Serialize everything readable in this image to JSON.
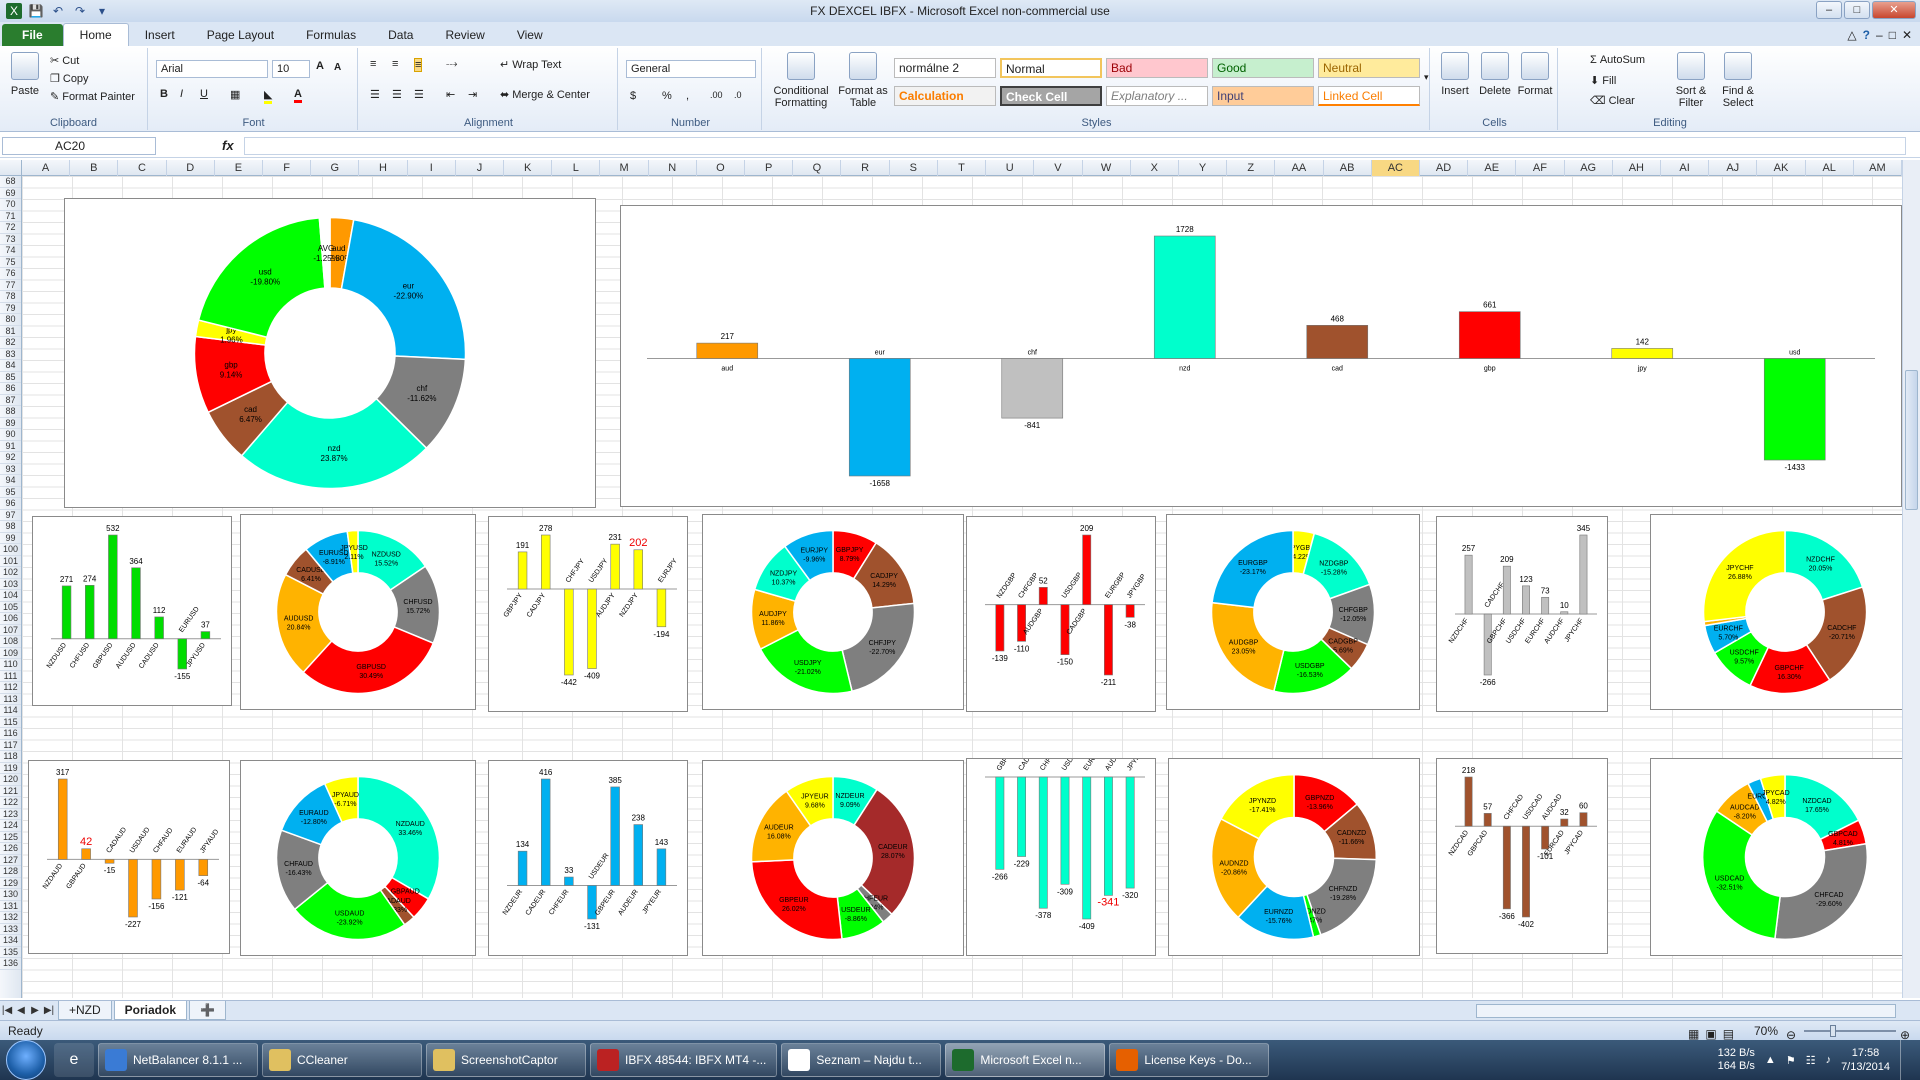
{
  "window": {
    "title": "FX DEXCEL IBFX - Microsoft Excel non-commercial use"
  },
  "tabs": [
    "File",
    "Home",
    "Insert",
    "Page Layout",
    "Formulas",
    "Data",
    "Review",
    "View"
  ],
  "ribbon": {
    "clipboard": {
      "paste": "Paste",
      "cut": "Cut",
      "copy": "Copy",
      "painter": "Format Painter",
      "label": "Clipboard"
    },
    "font": {
      "name": "Arial",
      "size": "10",
      "label": "Font"
    },
    "alignment": {
      "wrap": "Wrap Text",
      "merge": "Merge & Center",
      "label": "Alignment"
    },
    "number": {
      "format": "General",
      "label": "Number"
    },
    "styles": {
      "cond": "Conditional Formatting",
      "table": "Format as Table",
      "normal2": "normálne 2",
      "normal": "Normal",
      "bad": "Bad",
      "good": "Good",
      "neutral": "Neutral",
      "calc": "Calculation",
      "check": "Check Cell",
      "explan": "Explanatory ...",
      "input": "Input",
      "linked": "Linked Cell",
      "label": "Styles"
    },
    "cells": {
      "insert": "Insert",
      "delete": "Delete",
      "format": "Format",
      "label": "Cells"
    },
    "editing": {
      "autosum": "AutoSum",
      "fill": "Fill",
      "clear": "Clear",
      "sort": "Sort & Filter",
      "find": "Find & Select",
      "label": "Editing"
    }
  },
  "formula_bar": {
    "namebox": "AC20",
    "fx": "fx"
  },
  "columns": [
    "A",
    "B",
    "C",
    "D",
    "E",
    "F",
    "G",
    "H",
    "I",
    "J",
    "K",
    "L",
    "M",
    "N",
    "O",
    "P",
    "Q",
    "R",
    "S",
    "T",
    "U",
    "V",
    "W",
    "X",
    "Y",
    "Z",
    "AA",
    "AB",
    "AC",
    "AD",
    "AE",
    "AF",
    "AG",
    "AH",
    "AI",
    "AJ",
    "AK",
    "AL",
    "AM"
  ],
  "selected_column": "AC",
  "row_start": 68,
  "row_end": 136,
  "colors": {
    "aud": "#ff9900",
    "eur": "#00b0f0",
    "chf": "#7f7f7f",
    "nzd": "#00ffcc",
    "cad": "#a0522d",
    "gbp": "#ff0000",
    "jpy": "#ffff00",
    "usd": "#00ff00",
    "neg_usd": "#00cc00"
  },
  "chart_data": [
    {
      "type": "pie",
      "id": "main-donut",
      "slices": [
        {
          "label": "aud",
          "pct": "-2.80%",
          "value": 2.8,
          "color": "#ff9900"
        },
        {
          "label": "eur",
          "pct": "-22.90%",
          "value": 22.9,
          "color": "#00b0f0"
        },
        {
          "label": "chf",
          "pct": "-11.62%",
          "value": 11.62,
          "color": "#7f7f7f"
        },
        {
          "label": "nzd",
          "pct": "23.87%",
          "value": 23.87,
          "color": "#00ffcc"
        },
        {
          "label": "cad",
          "pct": "6.47%",
          "value": 6.47,
          "color": "#a0522d"
        },
        {
          "label": "gbp",
          "pct": "9.14%",
          "value": 9.14,
          "color": "#ff0000"
        },
        {
          "label": "jpy",
          "pct": "1.96%",
          "value": 1.96,
          "color": "#ffff00"
        },
        {
          "label": "usd",
          "pct": "-19.80%",
          "value": 19.8,
          "color": "#00ff00"
        },
        {
          "label": "AVG",
          "pct": "-1.25%",
          "value": 1.25,
          "color": "#ffffff"
        }
      ]
    },
    {
      "type": "bar",
      "id": "main-bar",
      "categories": [
        "aud",
        "eur",
        "chf",
        "nzd",
        "cad",
        "gbp",
        "jpy",
        "usd"
      ],
      "values": [
        217,
        -1658,
        -841,
        1728,
        468,
        661,
        142,
        -1433
      ],
      "colors": [
        "#ff9900",
        "#00b0f0",
        "#c0c0c0",
        "#00ffcc",
        "#a0522d",
        "#ff0000",
        "#ffff00",
        "#00ff00"
      ],
      "ylim": [
        -1800,
        1850
      ]
    },
    {
      "type": "bar",
      "id": "usd-bar",
      "categories": [
        "NZDUSD",
        "CHFUSD",
        "GBPUSD",
        "AUDUSD",
        "CADUSD",
        "EURUSD",
        "JPYUSD"
      ],
      "values": [
        271,
        274,
        532,
        364,
        112,
        -155,
        37
      ],
      "color": "#00dd00"
    },
    {
      "type": "pie",
      "id": "usd-donut",
      "slices": [
        {
          "label": "NZDUSD",
          "pct": "15.52%",
          "value": 15.52,
          "color": "#00ffcc"
        },
        {
          "label": "CHFUSD",
          "pct": "15.72%",
          "value": 15.72,
          "color": "#7f7f7f"
        },
        {
          "label": "GBPUSD",
          "pct": "30.49%",
          "value": 30.49,
          "color": "#ff0000"
        },
        {
          "label": "AUDUSD",
          "pct": "20.84%",
          "value": 20.84,
          "color": "#ffb300"
        },
        {
          "label": "CADUSD",
          "pct": "6.41%",
          "value": 6.41,
          "color": "#a0522d"
        },
        {
          "label": "EURUSD",
          "pct": "-8.91%",
          "value": 8.91,
          "color": "#00b0f0"
        },
        {
          "label": "JPYUSD",
          "pct": "2.11%",
          "value": 2.11,
          "color": "#ffff00"
        }
      ]
    },
    {
      "type": "bar",
      "id": "jpy-bar",
      "categories": [
        "GBPJPY",
        "CADJPY",
        "CHFJPY",
        "USDJPY",
        "AUDJPY",
        "NZDJPY",
        "EURJPY"
      ],
      "values": [
        191,
        278,
        -442,
        -409,
        231,
        202,
        -194
      ],
      "highlight": [
        5
      ],
      "color": "#ffff00"
    },
    {
      "type": "pie",
      "id": "jpy-donut",
      "slices": [
        {
          "label": "GBPJPY",
          "pct": "8.79%",
          "value": 8.79,
          "color": "#ff0000"
        },
        {
          "label": "CADJPY",
          "pct": "14.29%",
          "value": 14.29,
          "color": "#a0522d"
        },
        {
          "label": "CHFJPY",
          "pct": "-22.70%",
          "value": 22.7,
          "color": "#7f7f7f"
        },
        {
          "label": "USDJPY",
          "pct": "-21.02%",
          "value": 21.02,
          "color": "#00ff00"
        },
        {
          "label": "AUDJPY",
          "pct": "11.86%",
          "value": 11.86,
          "color": "#ffb300"
        },
        {
          "label": "NZDJPY",
          "pct": "10.37%",
          "value": 10.37,
          "color": "#00ffcc"
        },
        {
          "label": "EURJPY",
          "pct": "-9.96%",
          "value": 9.96,
          "color": "#00b0f0"
        }
      ]
    },
    {
      "type": "bar",
      "id": "gbp-bar",
      "categories": [
        "NZDGBP",
        "CHFGBP",
        "AUDGBP",
        "USDGBP",
        "CADGBP",
        "EURGBP",
        "JPYGBP"
      ],
      "values": [
        -139,
        -110,
        52,
        -150,
        209,
        -211,
        -38
      ],
      "color": "#ff0000"
    },
    {
      "type": "pie",
      "id": "gbp-donut",
      "slices": [
        {
          "label": "JPYGBP",
          "pct": "-4.22%",
          "value": 4.22,
          "color": "#ffff00"
        },
        {
          "label": "NZDGBP",
          "pct": "-15.28%",
          "value": 15.28,
          "color": "#00ffcc"
        },
        {
          "label": "CHFGBP",
          "pct": "-12.05%",
          "value": 12.05,
          "color": "#7f7f7f"
        },
        {
          "label": "CADGBP",
          "pct": "5.69%",
          "value": 5.69,
          "color": "#a0522d"
        },
        {
          "label": "USDGBP",
          "pct": "-16.53%",
          "value": 16.53,
          "color": "#00ff00"
        },
        {
          "label": "AUDGBP",
          "pct": "23.05%",
          "value": 23.05,
          "color": "#ffb300"
        },
        {
          "label": "EURGBP",
          "pct": "-23.17%",
          "value": 23.17,
          "color": "#00b0f0"
        }
      ]
    },
    {
      "type": "bar",
      "id": "chf-bar",
      "categories": [
        "NZDCHF",
        "CADCHF",
        "GBPCHF",
        "USDCHF",
        "EURCHF",
        "AUDCHF",
        "JPYCHF"
      ],
      "values": [
        257,
        -266,
        209,
        123,
        73,
        10,
        345
      ],
      "color": "#c0c0c0"
    },
    {
      "type": "pie",
      "id": "chf-donut",
      "slices": [
        {
          "label": "NZDCHF",
          "pct": "20.05%",
          "value": 20.05,
          "color": "#00ffcc"
        },
        {
          "label": "CADCHF",
          "pct": "-20.71%",
          "value": 20.71,
          "color": "#a0522d"
        },
        {
          "label": "GBPCHF",
          "pct": "16.30%",
          "value": 16.3,
          "color": "#ff0000"
        },
        {
          "label": "USDCHF",
          "pct": "9.57%",
          "value": 9.57,
          "color": "#00ff00"
        },
        {
          "label": "EURCHF",
          "pct": "5.70%",
          "value": 5.7,
          "color": "#00b0f0"
        },
        {
          "label": "AUDCHF",
          "pct": "",
          "value": 0.8,
          "color": "#ffb300"
        },
        {
          "label": "JPYCHF",
          "pct": "26.88%",
          "value": 26.88,
          "color": "#ffff00"
        }
      ]
    },
    {
      "type": "bar",
      "id": "aud-bar",
      "categories": [
        "NZDAUD",
        "GBPAUD",
        "CADAUD",
        "USDAUD",
        "CHFAUD",
        "EURAUD",
        "JPYAUD"
      ],
      "values": [
        317,
        42,
        -15,
        -227,
        -156,
        -121,
        -64
      ],
      "highlight": [
        1
      ],
      "color": "#ff9900"
    },
    {
      "type": "pie",
      "id": "aud-donut",
      "slices": [
        {
          "label": "NZDAUD",
          "pct": "33.46%",
          "value": 33.46,
          "color": "#00ffcc"
        },
        {
          "label": "GBPAUD",
          "pct": "",
          "value": 4.6,
          "color": "#ff0000"
        },
        {
          "label": "CADAUD",
          "pct": "-2.33%",
          "value": 2.33,
          "color": "#a0522d"
        },
        {
          "label": "USDAUD",
          "pct": "-23.92%",
          "value": 23.92,
          "color": "#00ff00"
        },
        {
          "label": "CHFAUD",
          "pct": "-16.43%",
          "value": 16.43,
          "color": "#7f7f7f"
        },
        {
          "label": "EURAUD",
          "pct": "-12.80%",
          "value": 12.8,
          "color": "#00b0f0"
        },
        {
          "label": "JPYAUD",
          "pct": "-6.71%",
          "value": 6.71,
          "color": "#ffff00"
        }
      ]
    },
    {
      "type": "bar",
      "id": "eur-bar",
      "categories": [
        "NZDEUR",
        "CADEUR",
        "CHFEUR",
        "USDEUR",
        "GBPEUR",
        "AUDEUR",
        "JPYEUR"
      ],
      "values": [
        134,
        416,
        33,
        -131,
        385,
        238,
        143
      ],
      "color": "#00b0f0"
    },
    {
      "type": "pie",
      "id": "eur-donut",
      "slices": [
        {
          "label": "NZDEUR",
          "pct": "9.09%",
          "value": 9.09,
          "color": "#00ffcc"
        },
        {
          "label": "CADEUR",
          "pct": "28.07%",
          "value": 28.07,
          "color": "#a52a2a"
        },
        {
          "label": "CHFEUR",
          "pct": "2.24%",
          "value": 2.24,
          "color": "#7f7f7f"
        },
        {
          "label": "USDEUR",
          "pct": "-8.86%",
          "value": 8.86,
          "color": "#00ff00"
        },
        {
          "label": "GBPEUR",
          "pct": "26.02%",
          "value": 26.02,
          "color": "#ff0000"
        },
        {
          "label": "AUDEUR",
          "pct": "16.08%",
          "value": 16.08,
          "color": "#ffb300"
        },
        {
          "label": "JPYEUR",
          "pct": "9.68%",
          "value": 9.68,
          "color": "#ffff00"
        }
      ]
    },
    {
      "type": "bar",
      "id": "nzd-bar",
      "categories": [
        "GBPNZD",
        "CADNZD",
        "CHFNZD",
        "USDNZD",
        "EURNZD",
        "AUDNZD",
        "JPYNZD"
      ],
      "values": [
        -266,
        -229,
        -378,
        -309,
        -409,
        -341,
        -320
      ],
      "highlight": [
        5
      ],
      "color": "#00ffcc"
    },
    {
      "type": "pie",
      "id": "nzd-donut",
      "slices": [
        {
          "label": "GBPNZD",
          "pct": "-13.96%",
          "value": 13.96,
          "color": "#ff0000"
        },
        {
          "label": "CADNZD",
          "pct": "-11.66%",
          "value": 11.66,
          "color": "#a0522d"
        },
        {
          "label": "CHFNZD",
          "pct": "-19.28%",
          "value": 19.28,
          "color": "#7f7f7f"
        },
        {
          "label": "USDNZD",
          "pct": "-1.47%",
          "value": 1.47,
          "color": "#00ff00"
        },
        {
          "label": "EURNZD",
          "pct": "-15.76%",
          "value": 15.76,
          "color": "#00b0f0"
        },
        {
          "label": "AUDNZD",
          "pct": "-20.86%",
          "value": 20.86,
          "color": "#ffb300"
        },
        {
          "label": "JPYNZD",
          "pct": "-17.41%",
          "value": 17.41,
          "color": "#ffff00"
        }
      ]
    },
    {
      "type": "bar",
      "id": "cad-bar",
      "categories": [
        "NZDCAD",
        "GBPCAD",
        "CHFCAD",
        "USDCAD",
        "AUDCAD",
        "EURCAD",
        "JPYCAD"
      ],
      "values": [
        218,
        57,
        -366,
        -402,
        -101,
        32,
        60
      ],
      "color": "#a0522d"
    },
    {
      "type": "pie",
      "id": "cad-donut",
      "slices": [
        {
          "label": "NZDCAD",
          "pct": "17.65%",
          "value": 17.65,
          "color": "#00ffcc"
        },
        {
          "label": "GBPCAD",
          "pct": "4.81%",
          "value": 4.81,
          "color": "#ff0000"
        },
        {
          "label": "CHFCAD",
          "pct": "-29.60%",
          "value": 29.6,
          "color": "#7f7f7f"
        },
        {
          "label": "USDCAD",
          "pct": "-32.51%",
          "value": 32.51,
          "color": "#00ff00"
        },
        {
          "label": "AUDCAD",
          "pct": "-8.20%",
          "value": 8.2,
          "color": "#ffb300"
        },
        {
          "label": "EURCAD",
          "pct": "",
          "value": 2.6,
          "color": "#00b0f0"
        },
        {
          "label": "JPYCAD",
          "pct": "4.82%",
          "value": 4.82,
          "color": "#ffff00"
        }
      ]
    }
  ],
  "sheets": [
    "+NZD",
    "Poriadok"
  ],
  "active_sheet": "Poriadok",
  "status": {
    "ready": "Ready",
    "zoom": "70%"
  },
  "taskbar": {
    "items": [
      "NetBalancer 8.1.1 ...",
      "CCleaner",
      "ScreenshotCaptor",
      "IBFX 48544: IBFX MT4 -...",
      "Seznam – Najdu t...",
      "Microsoft Excel n...",
      "License Keys - Do..."
    ],
    "active": 5,
    "net_up": "132 B/s",
    "net_down": "164 B/s",
    "time": "17:58",
    "date": "7/13/2014"
  }
}
